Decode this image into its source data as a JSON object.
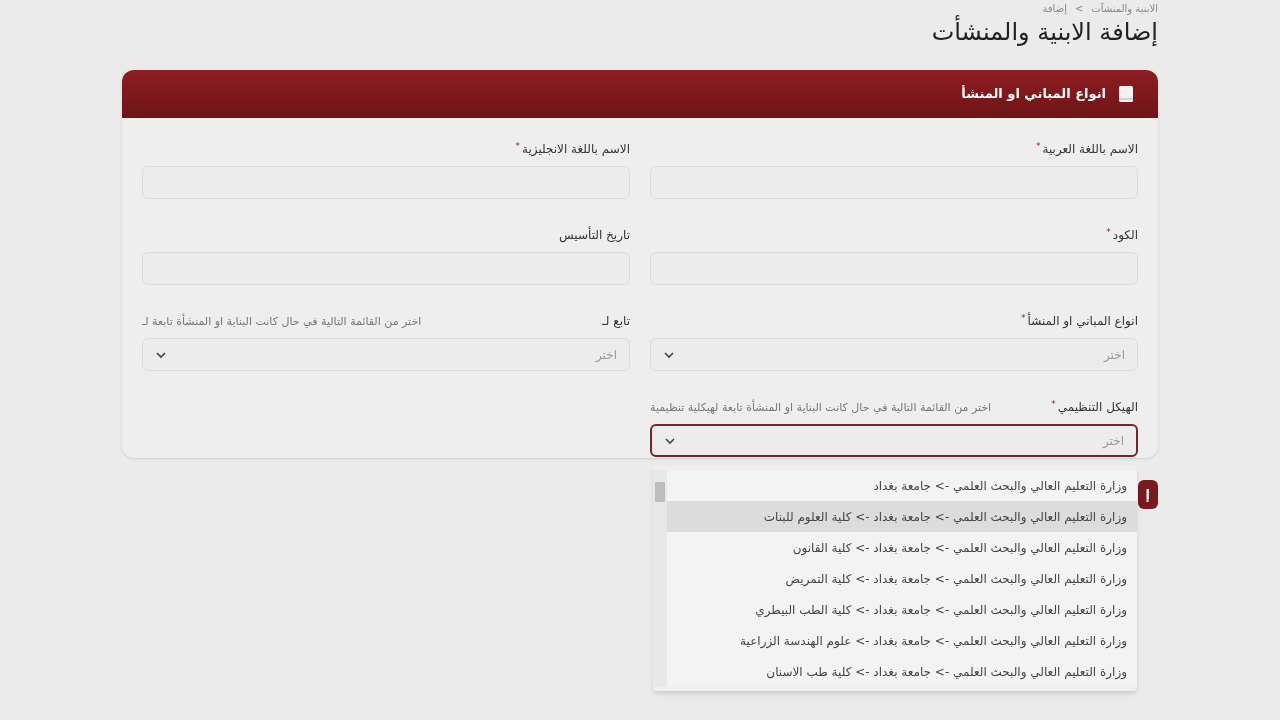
{
  "breadcrumb": [
    "الابنية والمنشآت",
    "إضافة"
  ],
  "breadcrumb_separator": ">",
  "required_mark": "*",
  "title": "إضافة الابنية والمنشأت",
  "card": {
    "title": "انواع المباني او المنشأ",
    "fields": [
      {
        "kind": "text",
        "label": "الاسم باللغة العربية",
        "required": true
      },
      {
        "kind": "text",
        "label": "الاسم باللغة الانجليزية",
        "required": true
      },
      {
        "kind": "text",
        "label": "الكود",
        "required": true
      },
      {
        "kind": "text",
        "label": "تاريخ التأسيس",
        "required": false
      },
      {
        "kind": "select",
        "label": "انواع المباني او المنشأ",
        "required": true,
        "placeholder": "اختر",
        "focused": false
      },
      {
        "kind": "select",
        "label": "تابع لـ",
        "required": false,
        "hint": "اختر من القائمة التالية في حال كانت البناية او المنشأة تابعة لـ",
        "placeholder": "اختر",
        "focused": false
      },
      {
        "kind": "select",
        "label": "الهيكل التنظيمي",
        "required": true,
        "hint": "اختر من القائمة التالية في حال كانت البناية او المنشأة تابعة لهيكلية تنظيمية",
        "placeholder": "اختر",
        "focused": true,
        "expanded": true,
        "options": [
          {
            "label": "وزارة التعليم العالي والبحث العلمي -> جامعة بغداد",
            "highlighted": false
          },
          {
            "label": "وزارة التعليم العالي والبحث العلمي -> جامعة بغداد -> كلية العلوم للبنات",
            "highlighted": true
          },
          {
            "label": "وزارة التعليم العالي والبحث العلمي -> جامعة بغداد -> كلية القانون",
            "highlighted": false
          },
          {
            "label": "وزارة التعليم العالي والبحث العلمي -> جامعة بغداد -> كلية التمريض",
            "highlighted": false
          },
          {
            "label": "وزارة التعليم العالي والبحث العلمي -> جامعة بغداد -> كلية الطب البيطري",
            "highlighted": false
          },
          {
            "label": "وزارة التعليم العالي والبحث العلمي -> جامعة بغداد -> علوم الهندسة الزراعية",
            "highlighted": false
          },
          {
            "label": "وزارة التعليم العالي والبحث العلمي -> جامعة بغداد -> كلية طب الاسنان",
            "highlighted": false
          }
        ]
      }
    ]
  },
  "submit_button": "إ"
}
